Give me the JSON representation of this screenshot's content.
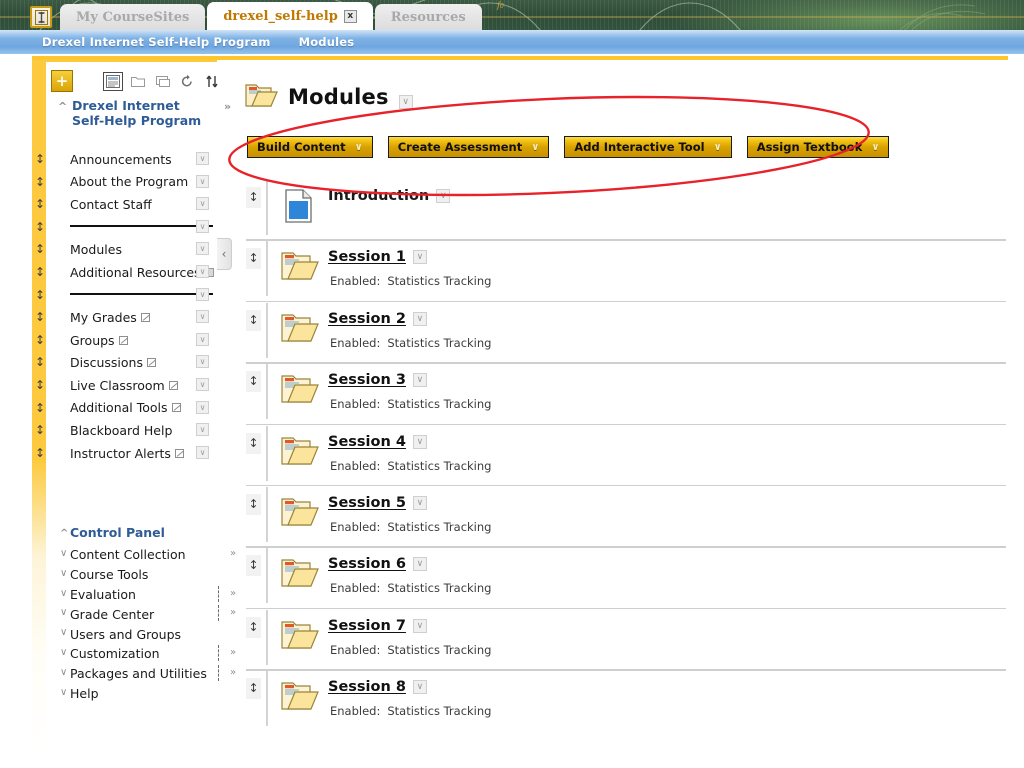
{
  "browser": {
    "home_icon": "home-tab-icon",
    "tabs": [
      {
        "label": "My CourseSites",
        "active": false,
        "closable": false
      },
      {
        "label": "drexel_self-help",
        "active": true,
        "closable": true,
        "close_label": "x"
      },
      {
        "label": "Resources",
        "active": false,
        "closable": false
      }
    ]
  },
  "breadcrumb": {
    "course": "Drexel Internet Self-Help Program",
    "section": "Modules"
  },
  "sidebar": {
    "toolbar": {
      "add_label": "+",
      "icons": [
        "list-view-icon",
        "folder-view-icon",
        "tile-view-icon",
        "refresh-icon",
        "sort-icon"
      ]
    },
    "course_title": "Drexel Internet Self-Help Program",
    "items": [
      {
        "label": "Announcements",
        "badge": null
      },
      {
        "label": "About the Program",
        "badge": null
      },
      {
        "label": "Contact Staff",
        "badge": null
      },
      {
        "label": "__DIVIDER__",
        "badge": null
      },
      {
        "label": "Modules",
        "badge": null
      },
      {
        "label": "Additional Resources",
        "badge": "grid"
      },
      {
        "label": "__DIVIDER__",
        "badge": null
      },
      {
        "label": "My Grades",
        "badge": "edit"
      },
      {
        "label": "Groups",
        "badge": "edit"
      },
      {
        "label": "Discussions",
        "badge": "edit"
      },
      {
        "label": "Live Classroom",
        "badge": "edit"
      },
      {
        "label": "Additional Tools",
        "badge": "edit"
      },
      {
        "label": "Blackboard Help",
        "badge": null
      },
      {
        "label": "Instructor Alerts",
        "badge": "edit"
      }
    ],
    "control_panel": {
      "title": "Control Panel",
      "items": [
        {
          "label": "Content Collection",
          "more": true,
          "dotted": false
        },
        {
          "label": "Course Tools",
          "more": false,
          "dotted": false
        },
        {
          "label": "Evaluation",
          "more": true,
          "dotted": true
        },
        {
          "label": "Grade Center",
          "more": true,
          "dotted": true
        },
        {
          "label": "Users and Groups",
          "more": false,
          "dotted": false
        },
        {
          "label": "Customization",
          "more": true,
          "dotted": true
        },
        {
          "label": "Packages and Utilities",
          "more": true,
          "dotted": true
        },
        {
          "label": "Help",
          "more": false,
          "dotted": false
        }
      ]
    },
    "collapse_label": "‹"
  },
  "main": {
    "page_title": "Modules",
    "actions": [
      {
        "label": "Build Content"
      },
      {
        "label": "Create Assessment"
      },
      {
        "label": "Add Interactive Tool"
      },
      {
        "label": "Assign Textbook"
      }
    ],
    "rows": [
      {
        "title": "Introduction",
        "icon": "document-icon",
        "link": false,
        "meta_key": null,
        "meta_value": null
      },
      {
        "title": "Session 1",
        "icon": "folder-icon",
        "link": true,
        "meta_key": "Enabled:",
        "meta_value": "Statistics Tracking"
      },
      {
        "title": "Session 2",
        "icon": "folder-icon",
        "link": true,
        "meta_key": "Enabled:",
        "meta_value": "Statistics Tracking"
      },
      {
        "title": "Session 3",
        "icon": "folder-icon",
        "link": true,
        "meta_key": "Enabled:",
        "meta_value": "Statistics Tracking"
      },
      {
        "title": "Session 4",
        "icon": "folder-icon",
        "link": true,
        "meta_key": "Enabled:",
        "meta_value": "Statistics Tracking"
      },
      {
        "title": "Session 5",
        "icon": "folder-icon",
        "link": true,
        "meta_key": "Enabled:",
        "meta_value": "Statistics Tracking"
      },
      {
        "title": "Session 6",
        "icon": "folder-icon",
        "link": true,
        "meta_key": "Enabled:",
        "meta_value": "Statistics Tracking"
      },
      {
        "title": "Session 7",
        "icon": "folder-icon",
        "link": true,
        "meta_key": "Enabled:",
        "meta_value": "Statistics Tracking"
      },
      {
        "title": "Session 8",
        "icon": "folder-icon",
        "link": true,
        "meta_key": "Enabled:",
        "meta_value": "Statistics Tracking"
      }
    ]
  },
  "annotation": {
    "shape": "ellipse",
    "color": "#e8222a",
    "target": "action-buttons-row"
  },
  "colors": {
    "brand_gold": "#fdca3f",
    "button_gold": "#d8a000",
    "breadcrumb_blue": "#6ea6e0",
    "link_blue": "#2f5c96",
    "banner_green": "#32523c",
    "annotation_red": "#e8222a"
  }
}
